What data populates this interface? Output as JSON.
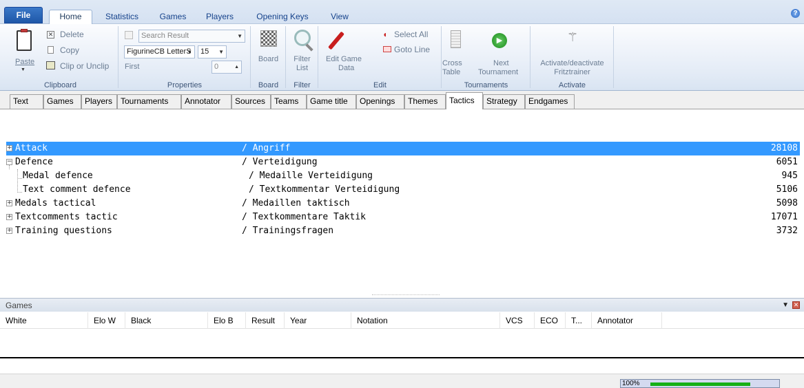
{
  "ribbon_tabs": [
    "File",
    "Home",
    "Statistics",
    "Games",
    "Players",
    "Opening Keys",
    "View"
  ],
  "active_tab": "Home",
  "clipboard": {
    "paste": "Paste",
    "delete": "Delete",
    "copy": "Copy",
    "clip": "Clip or Unclip",
    "label": "Clipboard"
  },
  "properties": {
    "search_result": "Search Result",
    "font": "FigurineCB LetterS",
    "size": "15",
    "first_label": "First",
    "first_value": "0",
    "label": "Properties"
  },
  "board": {
    "button": "Board",
    "label": "Board"
  },
  "filter": {
    "button_line1": "Filter",
    "button_line2": "List",
    "label": "Filter"
  },
  "edit": {
    "edit_line1": "Edit Game",
    "edit_line2": "Data",
    "select_all": "Select All",
    "goto_line": "Goto Line",
    "label": "Edit"
  },
  "tournaments": {
    "cross_line1": "Cross",
    "cross_line2": "Table",
    "next_line1": "Next",
    "next_line2": "Tournament",
    "label": "Tournaments"
  },
  "activate": {
    "line1": "Activate/deactivate",
    "line2": "Fritztrainer",
    "label": "Activate"
  },
  "db_tabs": [
    "Text",
    "Games",
    "Players",
    "Tournaments",
    "Annotator",
    "Sources",
    "Teams",
    "Game title",
    "Openings",
    "Themes",
    "Tactics",
    "Strategy",
    "Endgames"
  ],
  "active_db_tab": "Tactics",
  "tree_rows": [
    {
      "name": "Attack",
      "translation": "/ Angriff",
      "count": "28108",
      "selected": true
    },
    {
      "name": "Defence",
      "translation": "/ Verteidigung",
      "count": "6051"
    },
    {
      "name": "Medal defence",
      "translation": "/ Medaille Verteidigung",
      "count": "945"
    },
    {
      "name": "Text comment defence",
      "translation": "/ Textkommentar Verteidigung",
      "count": "5106"
    },
    {
      "name": "Medals tactical",
      "translation": "/ Medaillen taktisch",
      "count": "5098"
    },
    {
      "name": "Textcomments tactic",
      "translation": "/ Textkommentare Taktik",
      "count": "17071"
    },
    {
      "name": "Training questions",
      "translation": "/ Trainingsfragen",
      "count": "3732"
    }
  ],
  "games_panel": {
    "title": "Games",
    "columns": [
      "White",
      "Elo W",
      "Black",
      "Elo B",
      "Result",
      "Year",
      "Notation",
      "VCS",
      "ECO",
      "T...",
      "Annotator"
    ]
  },
  "status": {
    "progress_text": "100%",
    "progress": 1.0
  },
  "colors": {
    "selection": "#3399ff",
    "file_tab": "#1e57a8",
    "progress": "#16b016"
  }
}
